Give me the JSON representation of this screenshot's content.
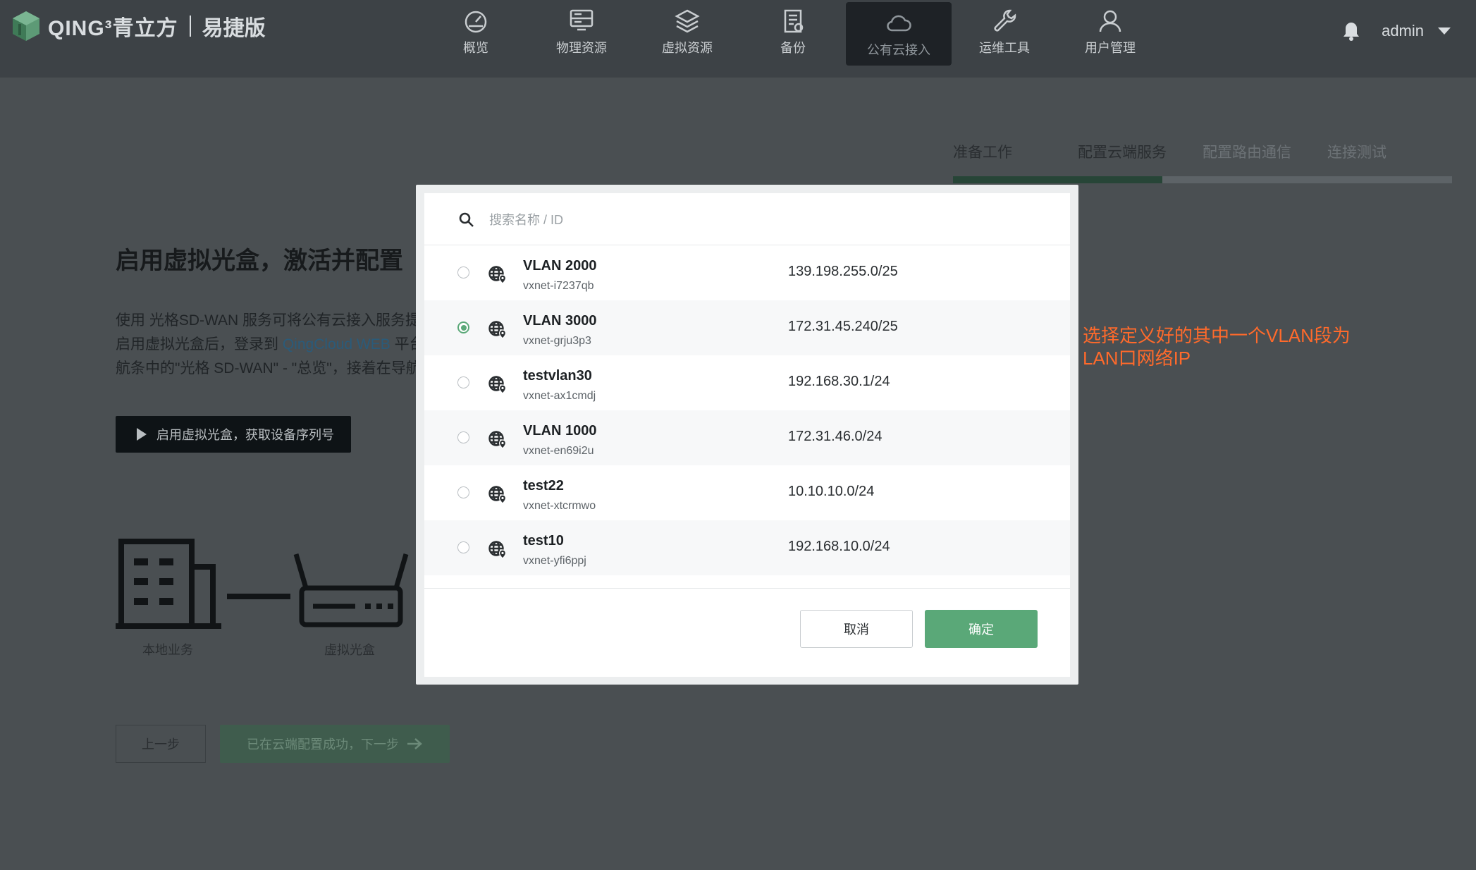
{
  "header": {
    "brand": "QING³青立方",
    "edition": "易捷版",
    "nav": [
      {
        "label": "概览",
        "icon": "dashboard-icon"
      },
      {
        "label": "物理资源",
        "icon": "server-icon"
      },
      {
        "label": "虚拟资源",
        "icon": "layers-icon"
      },
      {
        "label": "备份",
        "icon": "backup-icon"
      },
      {
        "label": "公有云接入",
        "icon": "cloud-icon",
        "active": true
      },
      {
        "label": "运维工具",
        "icon": "wrench-icon"
      },
      {
        "label": "用户管理",
        "icon": "user-icon"
      }
    ],
    "user": "admin"
  },
  "steps": {
    "items": [
      "准备工作",
      "配置云端服务",
      "配置路由通信",
      "连接测试"
    ],
    "progress": 0.42
  },
  "page": {
    "title": "启用虚拟光盒，激活并配置",
    "para_lines": [
      "使用 光格SD-WAN 服务可将公有云接入服务提",
      "启用虚拟光盒后，登录到 ",
      "航条中的\"光格 SD-WAN\" - \"总览\"，接着在导航"
    ],
    "para_link": "QingCloud WEB",
    "para_link_tail": " 平台",
    "enable_button": "启用虚拟光盒，获取设备序列号",
    "illus_local": "本地业务",
    "illus_box": "虚拟光盒",
    "prev_button": "上一步",
    "next_button": "已在云端配置成功，下一步"
  },
  "annotation": {
    "line1": "选择定义好的其中一个VLAN段为",
    "line2": "LAN口网络IP"
  },
  "modal": {
    "search_placeholder": "搜索名称 / ID",
    "rows": [
      {
        "name": "VLAN 2000",
        "id": "vxnet-i7237qb",
        "cidr": "139.198.255.0/25",
        "selected": false
      },
      {
        "name": "VLAN 3000",
        "id": "vxnet-grju3p3",
        "cidr": "172.31.45.240/25",
        "selected": true
      },
      {
        "name": "testvlan30",
        "id": "vxnet-ax1cmdj",
        "cidr": "192.168.30.1/24",
        "selected": false
      },
      {
        "name": "VLAN 1000",
        "id": "vxnet-en69i2u",
        "cidr": "172.31.46.0/24",
        "selected": false
      },
      {
        "name": "test22",
        "id": "vxnet-xtcrmwo",
        "cidr": "10.10.10.0/24",
        "selected": false
      },
      {
        "name": "test10",
        "id": "vxnet-yfi6ppj",
        "cidr": "192.168.10.0/24",
        "selected": false
      }
    ],
    "cancel": "取消",
    "confirm": "确定"
  }
}
